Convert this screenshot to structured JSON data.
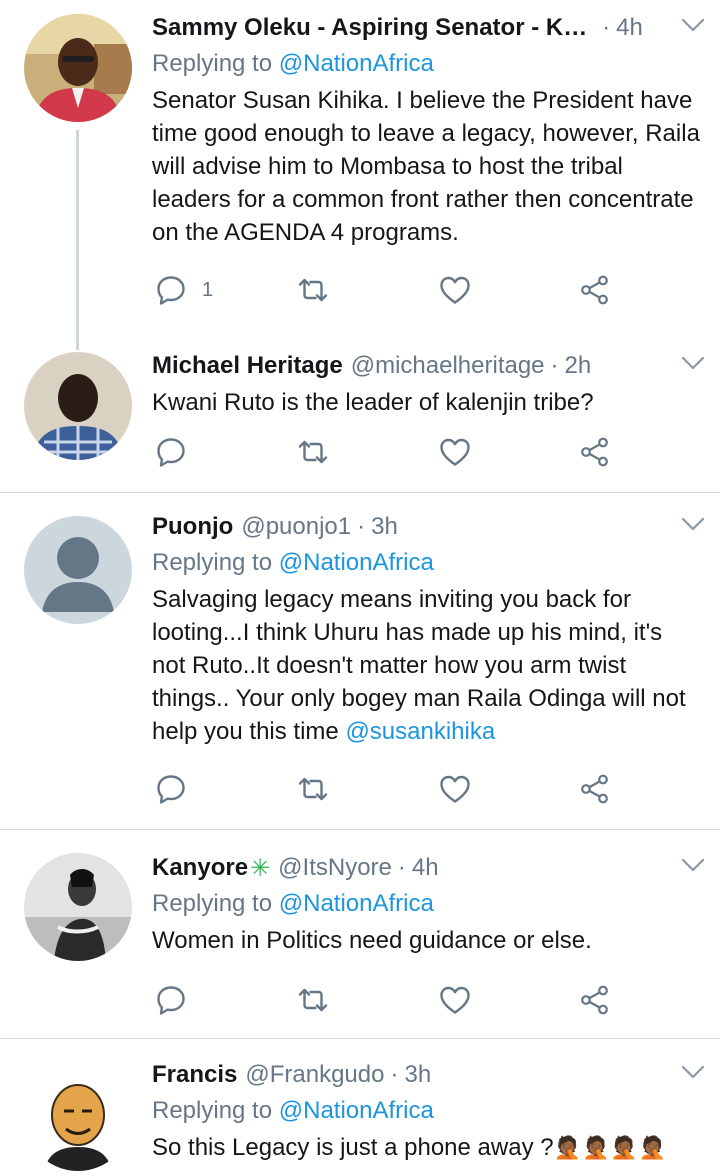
{
  "tweets": [
    {
      "name": "Sammy Oleku - Aspiring Senator - KJ...",
      "handle": "",
      "time": "4h",
      "reply_prefix": "Replying to",
      "reply_to": "@NationAfrica",
      "text": "Senator Susan Kihika. I believe the President have time good enough to leave a legacy, however, Raila will advise him to Mombasa to host the tribal leaders for a common front rather then concentrate on the AGENDA 4 programs.",
      "mention": "",
      "reply_count": "1",
      "avatar": "avatar-photo-man-red-shirt"
    },
    {
      "name": "Michael Heritage",
      "handle": "@michaelheritage",
      "time": "2h",
      "text": "Kwani Ruto is the leader of kalenjin tribe?",
      "reply_count": "",
      "avatar": "avatar-photo-man-plaid-shirt"
    },
    {
      "name": "Puonjo",
      "handle": "@puonjo1",
      "time": "3h",
      "reply_prefix": "Replying to",
      "reply_to": "@NationAfrica",
      "text": "Salvaging legacy means inviting you back for looting...I think Uhuru has made up his mind, it's not Ruto..It doesn't matter how you arm twist things.. Your only bogey man Raila Odinga will not help you this time ",
      "mention": "@susankihika",
      "reply_count": "",
      "avatar": "default-avatar"
    },
    {
      "name": "Kanyore",
      "name_suffix": "✳",
      "handle": "@ItsNyore",
      "time": "4h",
      "reply_prefix": "Replying to",
      "reply_to": "@NationAfrica",
      "text": "Women in Politics need guidance or else.",
      "reply_count": "",
      "avatar": "avatar-photo-woman-bw"
    },
    {
      "name": "Francis",
      "handle": "@Frankgudo",
      "time": "3h",
      "reply_prefix": "Replying to",
      "reply_to": "@NationAfrica",
      "text": "So this Legacy is just a phone away ?",
      "emoji": "🤦🏾🤦🏾🤦🏾🤦🏾",
      "avatar": "avatar-caricature-man"
    }
  ],
  "separator": "·",
  "colors": {
    "text": "#14171a",
    "secondary": "#657786",
    "link": "#1b95e0",
    "divider": "#d5dbe0",
    "sparkle": "#2fb550"
  }
}
